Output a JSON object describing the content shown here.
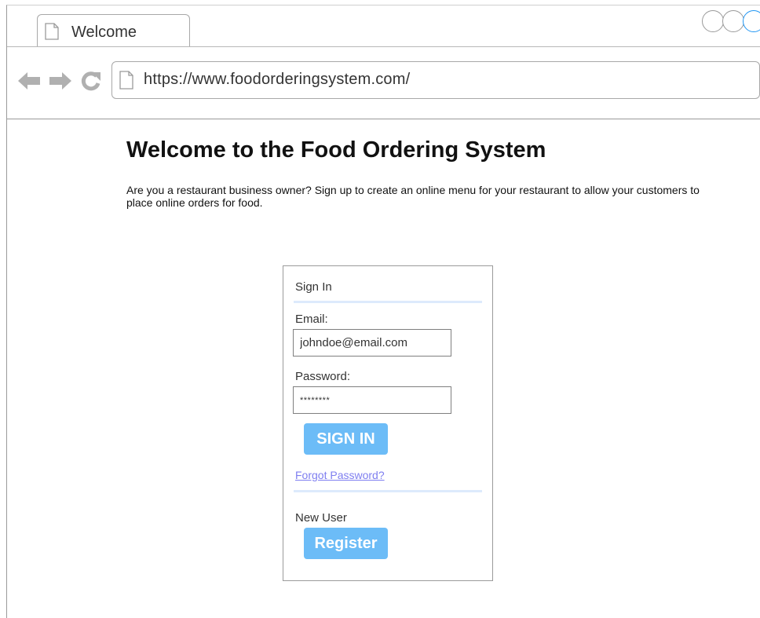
{
  "browser": {
    "tab_title": "Welcome",
    "url": "https://www.foodorderingsystem.com/"
  },
  "page": {
    "title": "Welcome to the Food Ordering System",
    "intro": "Are you a restaurant business owner? Sign up to create an online menu for your restaurant to allow your customers to place online orders for food."
  },
  "signin": {
    "heading": "Sign In",
    "email_label": "Email:",
    "email_value": "johndoe@email.com",
    "password_label": "Password:",
    "password_value": "********",
    "signin_button": "SIGN IN",
    "forgot_link": "Forgot Password?",
    "new_user_label": "New User",
    "register_button": "Register"
  },
  "colors": {
    "button_bg": "#6cbcf7",
    "link": "#7e7ef0",
    "separator": "#ddeafc",
    "window_control_active": "#2196f3"
  }
}
